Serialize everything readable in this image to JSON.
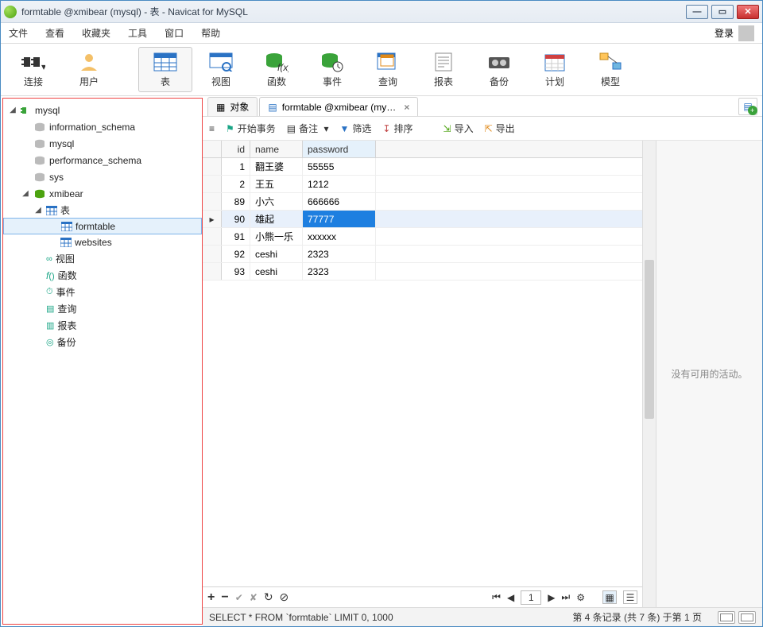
{
  "window": {
    "title": "formtable @xmibear (mysql) - 表 - Navicat for MySQL"
  },
  "menubar": {
    "items": [
      "文件",
      "查看",
      "收藏夹",
      "工具",
      "窗口",
      "帮助"
    ],
    "login": "登录"
  },
  "toolbar": {
    "items": [
      {
        "key": "connect",
        "label": "连接"
      },
      {
        "key": "user",
        "label": "用户"
      },
      {
        "key": "table",
        "label": "表"
      },
      {
        "key": "view",
        "label": "视图"
      },
      {
        "key": "function",
        "label": "函数"
      },
      {
        "key": "event",
        "label": "事件"
      },
      {
        "key": "query",
        "label": "查询"
      },
      {
        "key": "report",
        "label": "报表"
      },
      {
        "key": "backup",
        "label": "备份"
      },
      {
        "key": "schedule",
        "label": "计划"
      },
      {
        "key": "model",
        "label": "模型"
      }
    ]
  },
  "tree": {
    "nodes": [
      {
        "type": "conn",
        "label": "mysql",
        "expanded": true,
        "children": [
          {
            "type": "db-gray",
            "label": "information_schema"
          },
          {
            "type": "db-gray",
            "label": "mysql"
          },
          {
            "type": "db-gray",
            "label": "performance_schema"
          },
          {
            "type": "db-gray",
            "label": "sys"
          },
          {
            "type": "db-green",
            "label": "xmibear",
            "expanded": true,
            "children": [
              {
                "type": "folder-tables",
                "label": "表",
                "expanded": true,
                "children": [
                  {
                    "type": "table",
                    "label": "formtable",
                    "selected": true
                  },
                  {
                    "type": "table",
                    "label": "websites"
                  }
                ]
              },
              {
                "type": "folder",
                "icon": "view",
                "label": "视图"
              },
              {
                "type": "folder",
                "icon": "func",
                "label": "函数"
              },
              {
                "type": "folder",
                "icon": "event",
                "label": "事件"
              },
              {
                "type": "folder",
                "icon": "query",
                "label": "查询"
              },
              {
                "type": "folder",
                "icon": "report",
                "label": "报表"
              },
              {
                "type": "folder",
                "icon": "backup",
                "label": "备份"
              }
            ]
          }
        ]
      }
    ]
  },
  "tabs": {
    "items": [
      {
        "label": "对象",
        "icon": "grid",
        "active": false
      },
      {
        "label": "formtable @xmibear (mysql...",
        "icon": "table",
        "active": true,
        "closable": true
      }
    ]
  },
  "subtoolbar": {
    "begin": "开始事务",
    "memo": "备注",
    "filter": "筛选",
    "sort": "排序",
    "import": "导入",
    "export": "导出"
  },
  "grid": {
    "columns": [
      {
        "key": "id",
        "label": "id"
      },
      {
        "key": "name",
        "label": "name"
      },
      {
        "key": "password",
        "label": "password"
      }
    ],
    "rows": [
      {
        "id": "1",
        "name": "翻王婆",
        "password": "55555"
      },
      {
        "id": "2",
        "name": "王五",
        "password": "1212"
      },
      {
        "id": "89",
        "name": "小六",
        "password": "666666"
      },
      {
        "id": "90",
        "name": "雄起",
        "password": "77777",
        "selected": true,
        "cursor": true
      },
      {
        "id": "91",
        "name": "小熊一乐",
        "password": "xxxxxx"
      },
      {
        "id": "92",
        "name": "ceshi",
        "password": "2323"
      },
      {
        "id": "93",
        "name": "ceshi",
        "password": "2323"
      }
    ]
  },
  "gridfooter": {
    "page": "1"
  },
  "activity": {
    "empty": "没有可用的活动。"
  },
  "statusbar": {
    "query": "SELECT * FROM `formtable` LIMIT 0, 1000",
    "record": "第 4 条记录 (共 7 条) 于第 1 页"
  }
}
